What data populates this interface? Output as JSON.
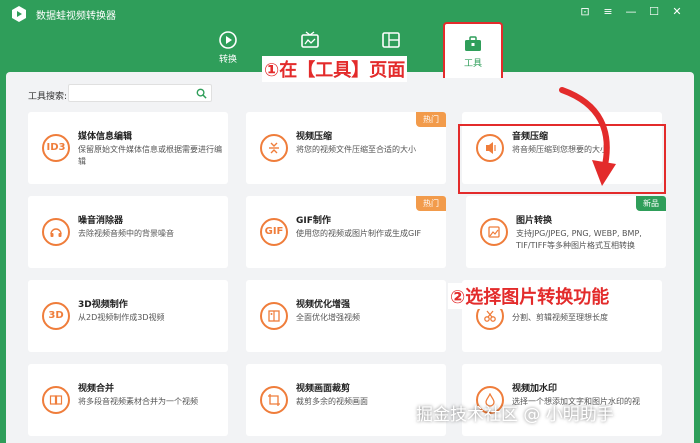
{
  "app": {
    "title": "数据蛙视频转换器"
  },
  "window_controls": [
    {
      "name": "feedback-icon",
      "glyph": "⊡"
    },
    {
      "name": "menu-icon",
      "glyph": "≡"
    },
    {
      "name": "minimize-icon",
      "glyph": "—"
    },
    {
      "name": "maximize-icon",
      "glyph": "☐"
    },
    {
      "name": "close-icon",
      "glyph": "✕"
    }
  ],
  "nav": {
    "tabs": [
      {
        "label": "转换",
        "icon": "convert-icon"
      },
      {
        "label": "",
        "icon": "mv-icon"
      },
      {
        "label": "",
        "icon": "collage-icon"
      },
      {
        "label": "工具",
        "icon": "toolbox-icon"
      }
    ]
  },
  "search": {
    "label": "工具搜索:",
    "placeholder": ""
  },
  "cards": [
    {
      "title": "媒体信息编辑",
      "desc": "保留原始文件媒体信息或根据需要进行编辑",
      "icon": "id3-icon",
      "icon_text": "ID3",
      "badge": ""
    },
    {
      "title": "视频压缩",
      "desc": "将您的视频文件压缩至合适的大小",
      "icon": "compress-icon",
      "icon_text": "",
      "badge": "热门"
    },
    {
      "title": "音频压缩",
      "desc": "将音频压缩到您想要的大小",
      "icon": "audio-compress-icon",
      "icon_text": "",
      "badge": ""
    },
    {
      "title": "噪音消除器",
      "desc": "去除视频音频中的背景噪音",
      "icon": "headphones-icon",
      "icon_text": "",
      "badge": ""
    },
    {
      "title": "GIF制作",
      "desc": "使用您的视频或图片制作或生成GIF",
      "icon": "gif-icon",
      "icon_text": "GIF",
      "badge": "热门"
    },
    {
      "title": "图片转换",
      "desc": "支持JPG/JPEG, PNG, WEBP, BMP, TIF/TIFF等多种图片格式互相转换",
      "icon": "image-convert-icon",
      "icon_text": "",
      "badge": "新品"
    },
    {
      "title": "3D视频制作",
      "desc": "从2D视频制作成3D视频",
      "icon": "3d-icon",
      "icon_text": "3D",
      "badge": ""
    },
    {
      "title": "视频优化增强",
      "desc": "全面优化增强视频",
      "icon": "enhance-icon",
      "icon_text": "",
      "badge": ""
    },
    {
      "title": "",
      "desc": "分割、剪辑视频至理想长度",
      "icon": "trim-icon",
      "icon_text": "",
      "badge": ""
    },
    {
      "title": "视频合并",
      "desc": "将多段音视频素材合并为一个视频",
      "icon": "merge-icon",
      "icon_text": "",
      "badge": ""
    },
    {
      "title": "视频画面裁剪",
      "desc": "裁剪多余的视频画面",
      "icon": "crop-icon",
      "icon_text": "",
      "badge": ""
    },
    {
      "title": "视频加水印",
      "desc": "选择一个想添加文字和图片水印的视",
      "icon": "watermark-icon",
      "icon_text": "",
      "badge": ""
    }
  ],
  "annotations": {
    "step1": "①在【工具】页面",
    "step2": "②选择图片转换功能"
  },
  "watermark": "掘金技术社区 @ 小明助手",
  "colors": {
    "brand": "#2f9e5a",
    "accent": "#ef7d3b",
    "highlight": "#e32b2b",
    "hot": "#f29b4b"
  }
}
